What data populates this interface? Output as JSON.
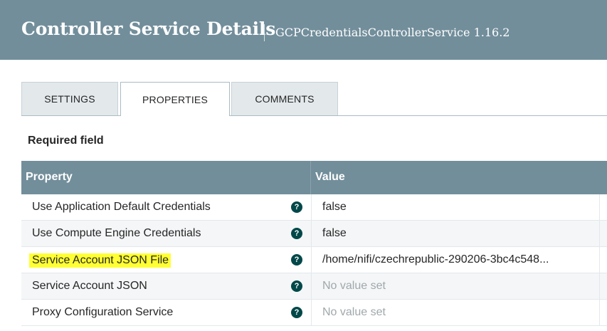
{
  "header": {
    "title": "Controller Service Details",
    "subtitle": "GCPCredentialsControllerService 1.16.2"
  },
  "tabs": [
    {
      "label": "SETTINGS",
      "active": false
    },
    {
      "label": "PROPERTIES",
      "active": true
    },
    {
      "label": "COMMENTS",
      "active": false
    }
  ],
  "required_label": "Required field",
  "table": {
    "columns": [
      "Property",
      "Value"
    ],
    "rows": [
      {
        "property": "Use Application Default Credentials",
        "value": "false",
        "empty": false,
        "highlighted": false
      },
      {
        "property": "Use Compute Engine Credentials",
        "value": "false",
        "empty": false,
        "highlighted": false
      },
      {
        "property": "Service Account JSON File",
        "value": "/home/nifi/czechrepublic-290206-3bc4c548...",
        "empty": false,
        "highlighted": true
      },
      {
        "property": "Service Account JSON",
        "value": "No value set",
        "empty": true,
        "highlighted": false
      },
      {
        "property": "Proxy Configuration Service",
        "value": "No value set",
        "empty": true,
        "highlighted": false
      }
    ],
    "help_icon": "question-circle-icon"
  },
  "colors": {
    "header_bg": "#728e9b",
    "highlight": "#ffff33",
    "help_icon": "#004849"
  }
}
